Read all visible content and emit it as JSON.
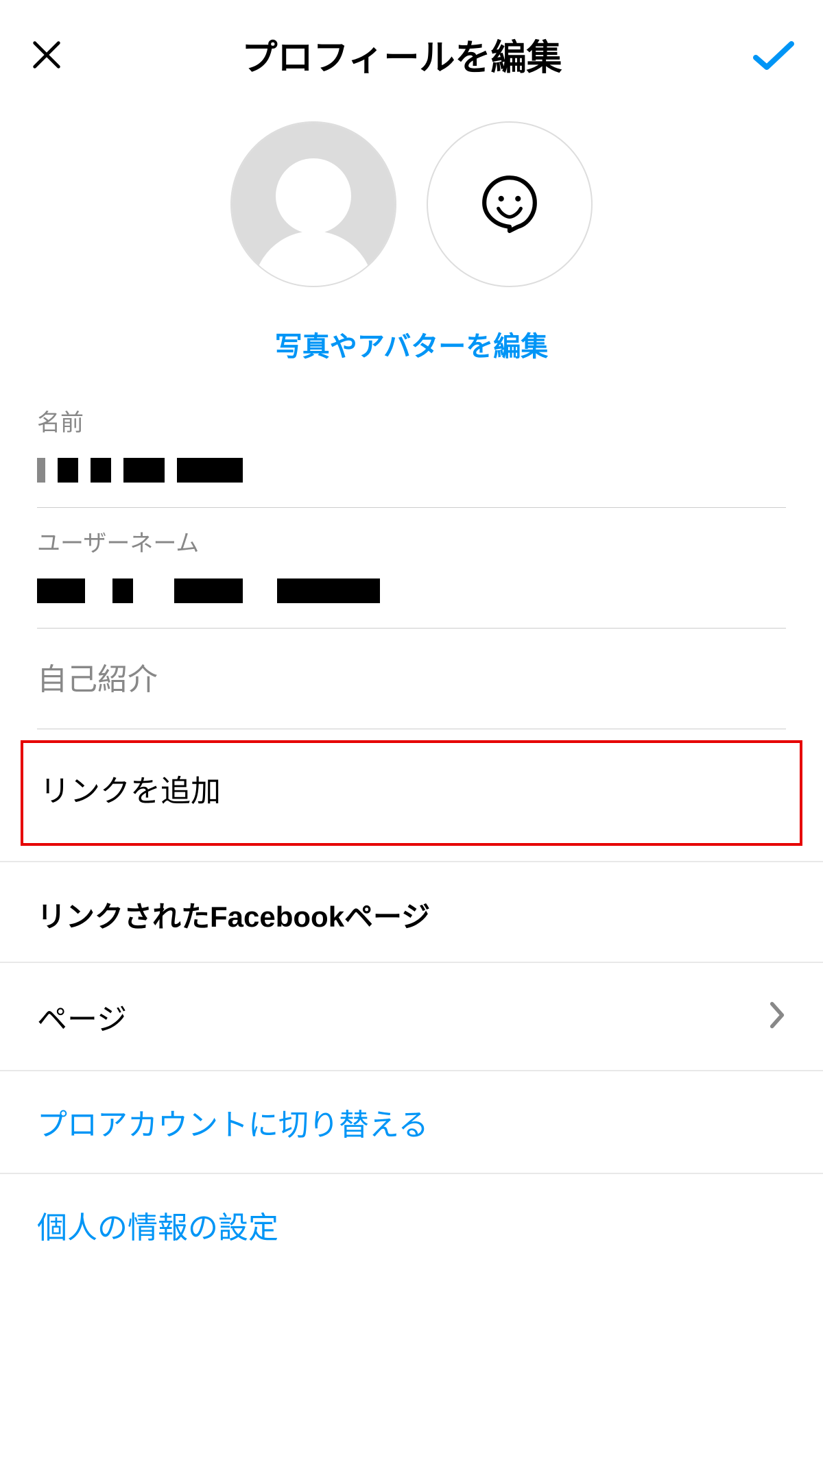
{
  "header": {
    "title": "プロフィールを編集"
  },
  "avatar": {
    "edit_link": "写真やアバターを編集"
  },
  "fields": {
    "name": {
      "label": "名前",
      "value": ""
    },
    "username": {
      "label": "ユーザーネーム",
      "value": ""
    },
    "bio": {
      "placeholder": "自己紹介"
    },
    "add_link": {
      "label": "リンクを追加"
    }
  },
  "linked_fb": {
    "title": "リンクされたFacebookページ",
    "page_label": "ページ"
  },
  "links": {
    "pro_account": "プロアカウントに切り替える",
    "personal_info": "個人の情報の設定"
  },
  "colors": {
    "primary_blue": "#0095f6",
    "highlight_red": "#e60000"
  }
}
